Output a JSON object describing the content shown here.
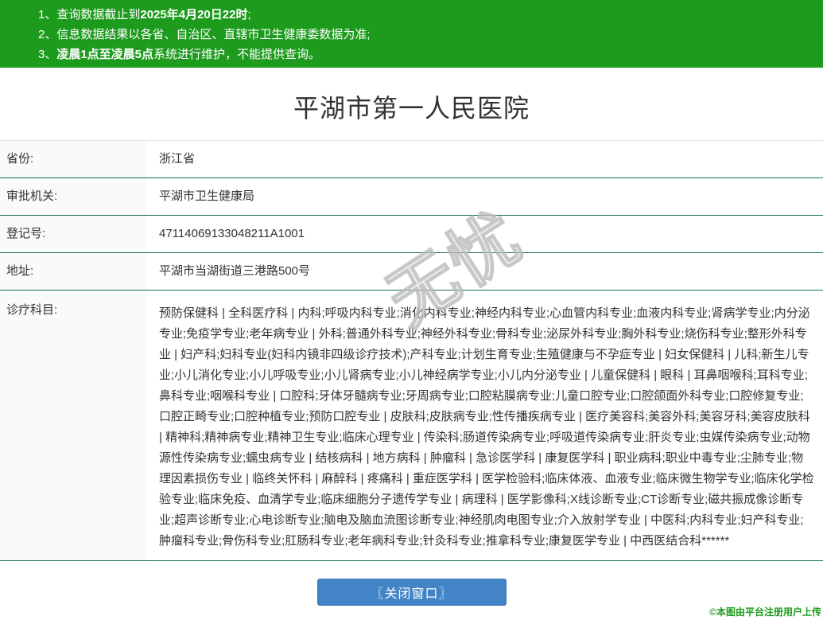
{
  "header": {
    "notices": [
      {
        "num": "1、",
        "pre": "查询数据截止到",
        "bold": "2025年4月20日22时",
        "post": ";"
      },
      {
        "num": "2、",
        "pre": "信息数据结果以各省、自治区、直辖市卫生健康委数据为准;",
        "bold": "",
        "post": ""
      },
      {
        "num": "3、",
        "pre": "",
        "bold": "凌晨1点至凌晨5点",
        "post": "系统进行维护，不能提供查询。"
      }
    ]
  },
  "title": "平湖市第一人民医院",
  "fields": [
    {
      "label": "省份:",
      "value": "浙江省"
    },
    {
      "label": "审批机关:",
      "value": "平湖市卫生健康局"
    },
    {
      "label": "登记号:",
      "value": "47114069133048211A1001"
    },
    {
      "label": "地址:",
      "value": "平湖市当湖街道三港路500号"
    },
    {
      "label": "诊疗科目:",
      "value": "预防保健科 | 全科医疗科 | 内科;呼吸内科专业;消化内科专业;神经内科专业;心血管内科专业;血液内科专业;肾病学专业;内分泌专业;免疫学专业;老年病专业 | 外科;普通外科专业;神经外科专业;骨科专业;泌尿外科专业;胸外科专业;烧伤科专业;整形外科专业 | 妇产科;妇科专业(妇科内镜非四级诊疗技术);产科专业;计划生育专业;生殖健康与不孕症专业 | 妇女保健科 | 儿科;新生儿专业;小儿消化专业;小儿呼吸专业;小儿肾病专业;小儿神经病学专业;小儿内分泌专业 | 儿童保健科 | 眼科 | 耳鼻咽喉科;耳科专业;鼻科专业;咽喉科专业 | 口腔科;牙体牙髓病专业;牙周病专业;口腔粘膜病专业;儿童口腔专业;口腔颌面外科专业;口腔修复专业;口腔正畸专业;口腔种植专业;预防口腔专业 | 皮肤科;皮肤病专业;性传播疾病专业 | 医疗美容科;美容外科;美容牙科;美容皮肤科 | 精神科;精神病专业;精神卫生专业;临床心理专业 | 传染科;肠道传染病专业;呼吸道传染病专业;肝炎专业;虫媒传染病专业;动物源性传染病专业;蠕虫病专业 | 结核病科 | 地方病科 | 肿瘤科 | 急诊医学科 | 康复医学科 | 职业病科;职业中毒专业;尘肺专业;物理因素损伤专业 | 临终关怀科 | 麻醉科 | 疼痛科 | 重症医学科 | 医学检验科;临床体液、血液专业;临床微生物学专业;临床化学检验专业;临床免疫、血清学专业;临床细胞分子遗传学专业 | 病理科 | 医学影像科;X线诊断专业;CT诊断专业;磁共振成像诊断专业;超声诊断专业;心电诊断专业;脑电及脑血流图诊断专业;神经肌肉电图专业;介入放射学专业 | 中医科;内科专业;妇产科专业;肿瘤科专业;骨伤科专业;肛肠科专业;老年病科专业;针灸科专业;推拿科专业;康复医学专业 | 中西医结合科******"
    }
  ],
  "close_button_label": "〖关闭窗口〗",
  "footer_credit": "©本图由平台注册用户上传",
  "watermark_text": "无忧",
  "colors": {
    "notice_green": "#1d9b1d",
    "row_border_green": "#1a7045",
    "label_bg": "#fafafa",
    "button_blue": "#4284c6",
    "text": "#333333"
  }
}
